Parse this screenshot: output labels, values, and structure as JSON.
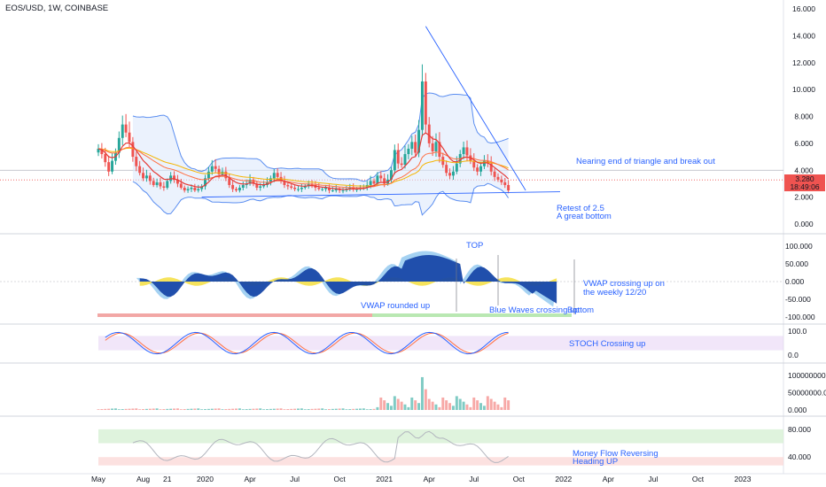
{
  "header": {
    "symbol": "EOS/USD, 1W, COINBASE"
  },
  "price_tag": {
    "price": "3.280",
    "countdown": "18:49:06"
  },
  "colors": {
    "up": "#26a69a",
    "down": "#ef5350",
    "accent": "#2962ff",
    "band": "#5b8ef0",
    "wave": "#1848a8",
    "wave_light": "#8fc7ef",
    "yellow": "#f5e04a"
  },
  "chart_data": [
    {
      "type": "candlestick",
      "panel": "price",
      "ylim": [
        0,
        16
      ],
      "y_ticks": [
        "0.000",
        "2.000",
        "4.000",
        "6.000",
        "8.000",
        "10.000",
        "12.000",
        "14.000",
        "16.000"
      ],
      "x_ticks": [
        "May",
        "Aug",
        "21",
        "2020",
        "Apr",
        "Jul",
        "Oct",
        "2021",
        "Apr",
        "Jul",
        "Oct",
        "2022",
        "Apr",
        "Jul",
        "Oct",
        "2023"
      ],
      "x_range_weeks": [
        0,
        196
      ],
      "tick_weeks": [
        0,
        13,
        20,
        31,
        44,
        57,
        70,
        83,
        96,
        109,
        122,
        135,
        148,
        161,
        174,
        187
      ],
      "closes": [
        5.6,
        5.2,
        4.6,
        3.9,
        4.7,
        5.3,
        6.4,
        7.4,
        6.8,
        6.1,
        5.0,
        4.3,
        3.8,
        3.4,
        3.6,
        3.2,
        2.9,
        3.1,
        2.8,
        2.7,
        3.2,
        3.6,
        3.3,
        3.0,
        2.7,
        2.5,
        2.6,
        2.7,
        2.5,
        2.6,
        2.8,
        3.4,
        3.9,
        4.3,
        4.1,
        3.7,
        3.9,
        3.4,
        2.9,
        2.6,
        2.5,
        2.7,
        2.9,
        3.0,
        3.3,
        3.0,
        2.7,
        2.8,
        2.9,
        3.1,
        3.4,
        3.8,
        3.5,
        3.2,
        2.9,
        2.8,
        2.7,
        2.6,
        2.6,
        2.7,
        2.8,
        3.0,
        2.9,
        2.7,
        2.6,
        2.6,
        2.7,
        2.5,
        2.5,
        2.6,
        2.5,
        2.5,
        2.6,
        2.7,
        2.6,
        2.6,
        2.7,
        2.7,
        2.9,
        3.2,
        3.0,
        3.6,
        3.4,
        3.0,
        3.3,
        4.0,
        5.5,
        4.5,
        4.4,
        5.2,
        5.6,
        6.1,
        5.3,
        7.0,
        10.6,
        7.4,
        6.0,
        5.4,
        6.1,
        5.0,
        4.4,
        3.8,
        3.6,
        3.9,
        4.5,
        5.2,
        5.7,
        5.1,
        4.7,
        4.2,
        3.9,
        4.3,
        4.7,
        4.5,
        3.9,
        3.5,
        3.3,
        3.1,
        2.9,
        2.5
      ],
      "closes_x_start_week": 0,
      "annotations": [
        "Nearing end of triangle and break out",
        "Retest of 2.5",
        "A great bottom"
      ]
    },
    {
      "type": "area",
      "panel": "waves",
      "y_ticks": [
        "100.000",
        "50.000",
        "0.000",
        "-50.000",
        "-100.000"
      ],
      "ylim": [
        -100,
        100
      ],
      "x_range_weeks": [
        12,
        133
      ],
      "annotations": [
        "TOP",
        "VWAP rounded up",
        "Blue Waves crossing up",
        "Bottom",
        "VWAP crossing up on",
        "the weekly 12/20"
      ]
    },
    {
      "type": "line",
      "panel": "stoch",
      "y_ticks": [
        "100.0",
        "0.0"
      ],
      "ylim": [
        0,
        100
      ],
      "annotations": [
        "STOCH Crossing up"
      ]
    },
    {
      "type": "bar",
      "panel": "volume",
      "y_ticks": [
        "100000000.000",
        "50000000.000",
        "0.000"
      ],
      "ylim": [
        0,
        110000000
      ]
    },
    {
      "type": "line",
      "panel": "money_flow",
      "y_ticks": [
        "80.000",
        "40.000"
      ],
      "ylim": [
        25,
        90
      ],
      "annotations": [
        "Money Flow Reversing",
        "Heading UP"
      ]
    }
  ]
}
